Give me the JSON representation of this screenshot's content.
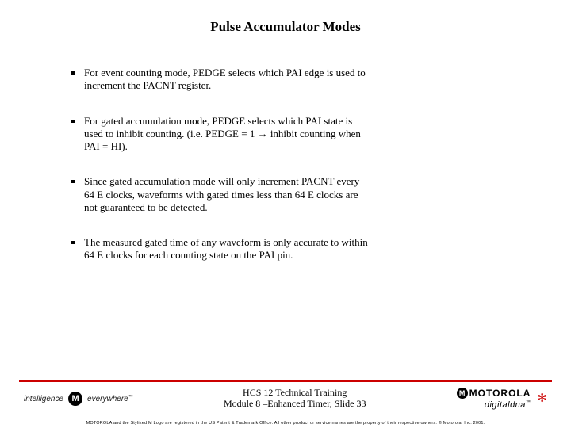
{
  "title": "Pulse Accumulator Modes",
  "bullets": [
    "For event counting mode, PEDGE selects which PAI edge is used to increment the PACNT register.",
    "For gated accumulation mode, PEDGE selects which PAI state  is used to  inhibit counting. (i.e. PEDGE = 1 →  inhibit counting when PAI = HI).",
    "Since gated accumulation mode will only increment PACNT every 64 E clocks, waveforms with gated times less than 64 E clocks are not guaranteed to be detected.",
    "The measured gated time of any waveform is only accurate to within 64 E clocks for each counting state on the PAI pin."
  ],
  "footer": {
    "left_intelligence": "intelligence",
    "left_m": "M",
    "left_everywhere": "everywhere",
    "center_line1": "HCS 12 Technical Training",
    "center_line2": "Module 8 –Enhanced Timer, Slide 33",
    "right_m": "M",
    "right_motorola": "MOTOROLA",
    "right_digitaldna": "digitaldna"
  },
  "legal": "MOTOROLA and the Stylized M Logo are registered in the US Patent & Trademark Office. All other product or service names are the property of their respective owners.  © Motorola, Inc. 2001."
}
